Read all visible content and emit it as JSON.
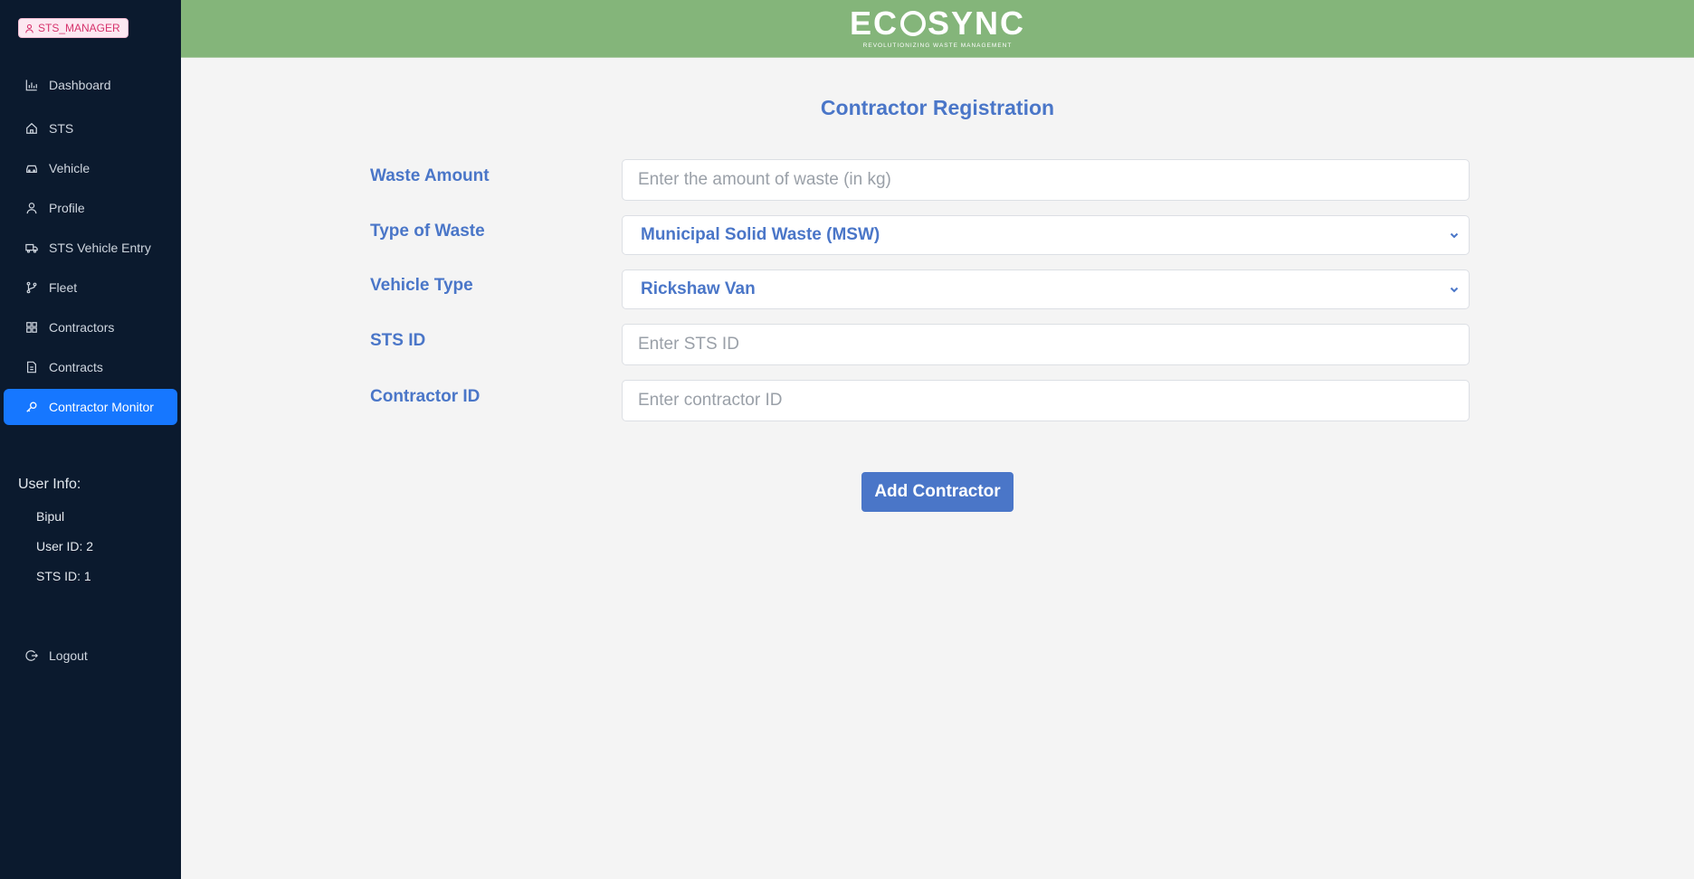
{
  "sidebar": {
    "role_badge": "STS_MANAGER",
    "nav": [
      {
        "label": "Dashboard",
        "icon": "bar-chart-icon"
      },
      {
        "label": "STS",
        "icon": "home-icon"
      },
      {
        "label": "Vehicle",
        "icon": "car-icon"
      },
      {
        "label": "Profile",
        "icon": "user-icon"
      },
      {
        "label": "STS Vehicle Entry",
        "icon": "truck-icon"
      },
      {
        "label": "Fleet",
        "icon": "git-branch-icon"
      },
      {
        "label": "Contractors",
        "icon": "grid-icon"
      },
      {
        "label": "Contracts",
        "icon": "file-icon"
      },
      {
        "label": "Contractor Monitor",
        "icon": "key-icon",
        "active": true
      }
    ],
    "user_info": {
      "title": "User Info:",
      "name": "Bipul",
      "user_id": "User ID: 2",
      "sts_id": "STS ID: 1"
    },
    "logout_label": "Logout"
  },
  "header": {
    "logo_text": "ECOSYNC",
    "logo_tagline": "REVOLUTIONIZING WASTE MANAGEMENT",
    "background_color": "#84b57a"
  },
  "form": {
    "title": "Contractor Registration",
    "fields": {
      "waste_amount": {
        "label": "Waste Amount",
        "placeholder": "Enter the amount of waste (in kg)",
        "value": ""
      },
      "waste_type": {
        "label": "Type of Waste",
        "selected": "Municipal Solid Waste (MSW)"
      },
      "vehicle_type": {
        "label": "Vehicle Type",
        "selected": "Rickshaw Van"
      },
      "sts_id": {
        "label": "STS ID",
        "placeholder": "Enter STS ID",
        "value": ""
      },
      "contractor_id": {
        "label": "Contractor ID",
        "placeholder": "Enter contractor ID",
        "value": ""
      }
    },
    "submit_label": "Add Contractor"
  },
  "colors": {
    "sidebar_bg": "#0b1a2e",
    "accent_blue": "#4a76c8",
    "active_nav": "#1677ff",
    "badge_pink": "#d6336c"
  }
}
